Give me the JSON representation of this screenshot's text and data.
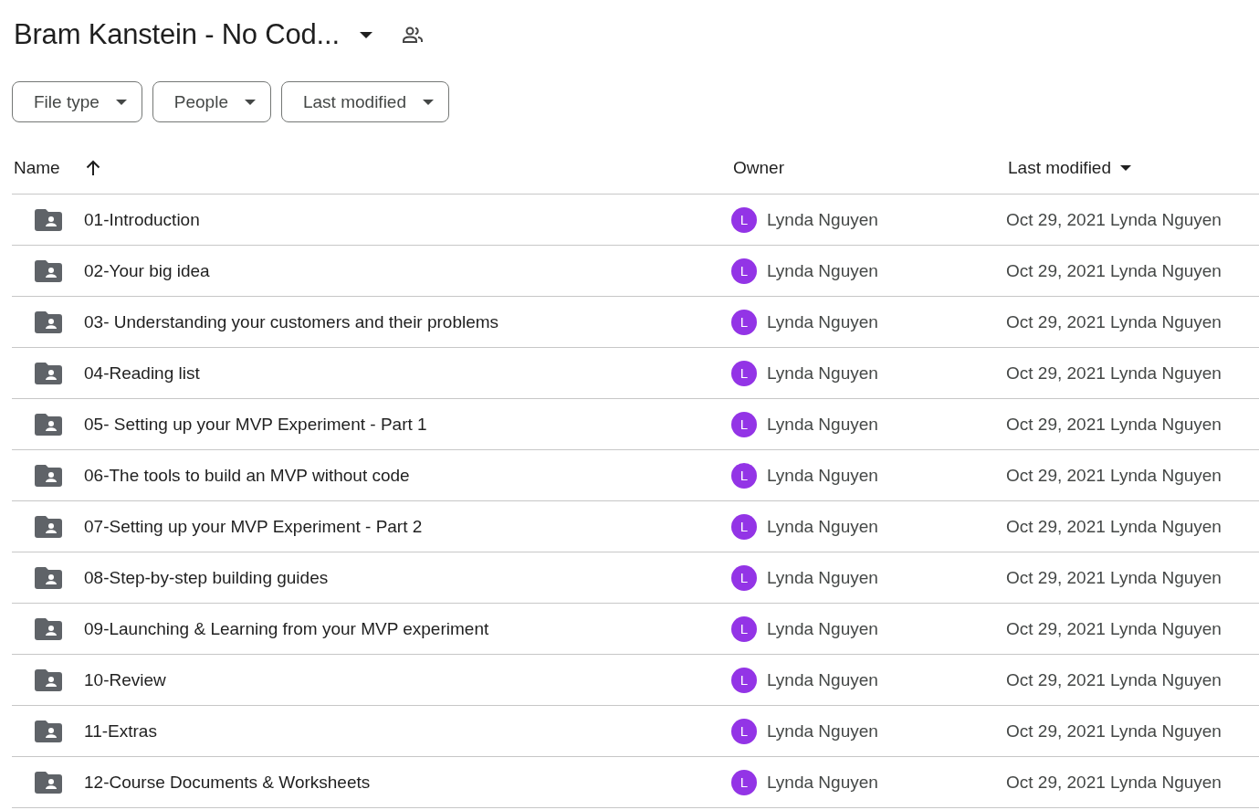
{
  "header": {
    "title": "Bram Kanstein - No Cod..."
  },
  "filters": [
    {
      "label": "File type"
    },
    {
      "label": "People"
    },
    {
      "label": "Last modified"
    }
  ],
  "table": {
    "columns": [
      "Name",
      "Owner",
      "Last modified"
    ],
    "rows": [
      {
        "name": "01-Introduction",
        "owner_initial": "L",
        "owner": "Lynda Nguyen",
        "modified": "Oct 29, 2021 Lynda Nguyen"
      },
      {
        "name": "02-Your big idea",
        "owner_initial": "L",
        "owner": "Lynda Nguyen",
        "modified": "Oct 29, 2021 Lynda Nguyen"
      },
      {
        "name": "03- Understanding your customers and their problems",
        "owner_initial": "L",
        "owner": "Lynda Nguyen",
        "modified": "Oct 29, 2021 Lynda Nguyen"
      },
      {
        "name": "04-Reading list",
        "owner_initial": "L",
        "owner": "Lynda Nguyen",
        "modified": "Oct 29, 2021 Lynda Nguyen"
      },
      {
        "name": "05- Setting up your MVP Experiment - Part 1",
        "owner_initial": "L",
        "owner": "Lynda Nguyen",
        "modified": "Oct 29, 2021 Lynda Nguyen"
      },
      {
        "name": "06-The tools to build an MVP without code",
        "owner_initial": "L",
        "owner": "Lynda Nguyen",
        "modified": "Oct 29, 2021 Lynda Nguyen"
      },
      {
        "name": "07-Setting up your MVP Experiment - Part 2",
        "owner_initial": "L",
        "owner": "Lynda Nguyen",
        "modified": "Oct 29, 2021 Lynda Nguyen"
      },
      {
        "name": "08-Step-by-step building guides",
        "owner_initial": "L",
        "owner": "Lynda Nguyen",
        "modified": "Oct 29, 2021 Lynda Nguyen"
      },
      {
        "name": "09-Launching & Learning from your MVP experiment",
        "owner_initial": "L",
        "owner": "Lynda Nguyen",
        "modified": "Oct 29, 2021 Lynda Nguyen"
      },
      {
        "name": "10-Review",
        "owner_initial": "L",
        "owner": "Lynda Nguyen",
        "modified": "Oct 29, 2021 Lynda Nguyen"
      },
      {
        "name": "11-Extras",
        "owner_initial": "L",
        "owner": "Lynda Nguyen",
        "modified": "Oct 29, 2021 Lynda Nguyen"
      },
      {
        "name": "12-Course Documents & Worksheets",
        "owner_initial": "L",
        "owner": "Lynda Nguyen",
        "modified": "Oct 29, 2021 Lynda Nguyen"
      }
    ]
  }
}
